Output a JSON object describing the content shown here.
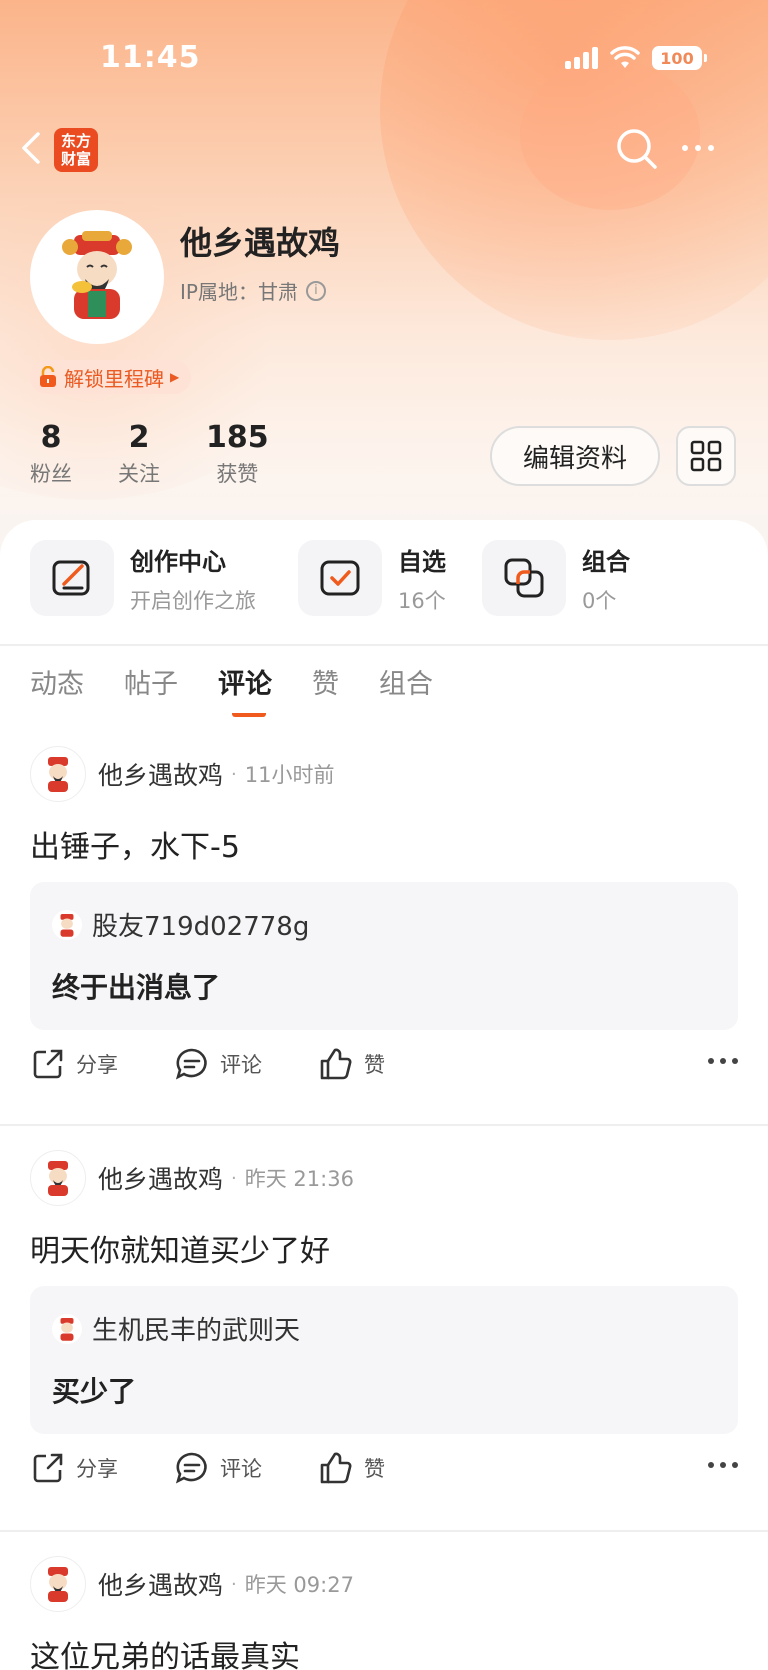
{
  "status": {
    "time": "11:45",
    "battery": "100"
  },
  "nav": {
    "logo_line1": "东方",
    "logo_line2": "财富"
  },
  "profile": {
    "name": "他乡遇故鸡",
    "ip_label": "IP属地：",
    "ip_value": "甘肃",
    "milestone": "解锁里程碑",
    "stats": [
      {
        "num": "8",
        "label": "粉丝"
      },
      {
        "num": "2",
        "label": "关注"
      },
      {
        "num": "185",
        "label": "获赞"
      }
    ],
    "edit_label": "编辑资料"
  },
  "shortcuts": [
    {
      "title": "创作中心",
      "sub": "开启创作之旅"
    },
    {
      "title": "自选",
      "sub": "16个"
    },
    {
      "title": "组合",
      "sub": "0个"
    }
  ],
  "tabs": [
    {
      "label": "动态"
    },
    {
      "label": "帖子"
    },
    {
      "label": "评论",
      "active": true
    },
    {
      "label": "赞"
    },
    {
      "label": "组合"
    }
  ],
  "posts": [
    {
      "author": "他乡遇故鸡",
      "time": "11小时前",
      "body": "出锤子，水下-5",
      "quote_name": "股友719d02778g",
      "quote_text": "终于出消息了"
    },
    {
      "author": "他乡遇故鸡",
      "time": "昨天 21:36",
      "body": "明天你就知道买少了好",
      "quote_name": "生机民丰的武则天",
      "quote_text": "买少了"
    },
    {
      "author": "他乡遇故鸡",
      "time": "昨天 09:27",
      "body": "这位兄弟的话最真实"
    }
  ],
  "actions": {
    "share": "分享",
    "comment": "评论",
    "like": "赞"
  },
  "colors": {
    "accent": "#f05a1c",
    "logo": "#ea4b21"
  }
}
